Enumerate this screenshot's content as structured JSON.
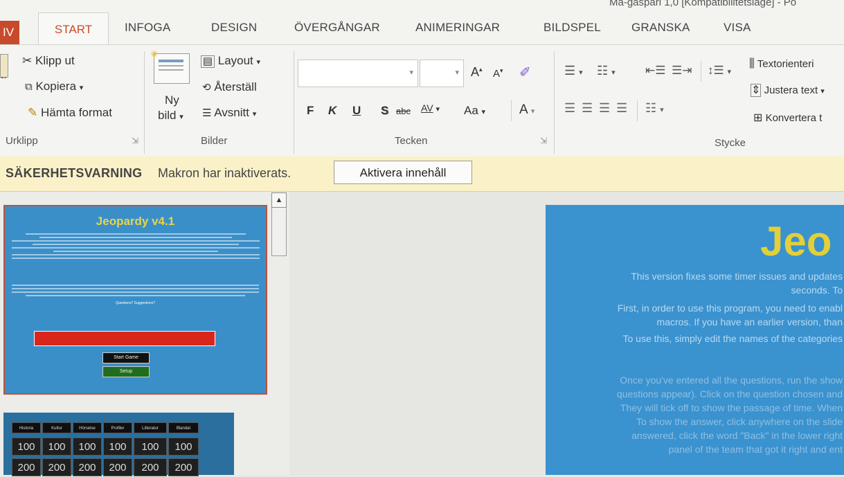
{
  "window": {
    "title": "Ma-gaspari 1,0 [Kompatibilitetslage] - Po"
  },
  "tabs": {
    "file": "IV",
    "start": "START",
    "infoga": "INFOGA",
    "design": "DESIGN",
    "overgangar": "ÖVERGÅNGAR",
    "animeringar": "ANIMERINGAR",
    "bildspel": "BILDSPEL",
    "granska": "GRANSKA",
    "visa": "VISA"
  },
  "ribbon": {
    "clipboard": {
      "cut": "Klipp ut",
      "copy": "Kopiera",
      "format_painter": "Hämta format",
      "paste_partial": "a",
      "group_label": "Urklipp"
    },
    "slides": {
      "new_slide_line1": "Ny",
      "new_slide_line2": "bild",
      "layout": "Layout",
      "reset": "Återställ",
      "section": "Avsnitt",
      "group_label": "Bilder"
    },
    "font": {
      "font_name_value": "",
      "font_size_value": "",
      "grow": "A",
      "shrink": "A",
      "bold": "F",
      "italic": "K",
      "underline": "U",
      "shadow": "S",
      "strike": "abc",
      "spacing": "AV",
      "change_case": "Aa",
      "font_color": "A",
      "group_label": "Tecken"
    },
    "paragraph": {
      "text_direction": "Textorienteri",
      "align_text": "Justera text",
      "convert": "Konvertera t",
      "group_label": "Stycke"
    }
  },
  "security_bar": {
    "title": "SÄKERHETSVARNING",
    "message": "Makron har inaktiverats.",
    "button": "Aktivera innehåll"
  },
  "thumbnails": {
    "slide1": {
      "title": "Jeopardy v4.1",
      "start_button": "Start Game",
      "setup_button": "Setup",
      "red_banner": "",
      "questions_line": "Questions? Suggestions?"
    },
    "slide2": {
      "categories": [
        "Historia",
        "Kultur",
        "Hörselse",
        "Profiler",
        "Litteratur",
        "Blandat"
      ],
      "row1": [
        "100",
        "100",
        "100",
        "100",
        "100",
        "100"
      ],
      "row2": [
        "200",
        "200",
        "200",
        "200",
        "200",
        "200"
      ]
    }
  },
  "main_slide": {
    "title_partial": "Jeo",
    "lines": [
      "This version fixes some timer issues and updates",
      "seconds. To",
      "First, in order to use this program, you need to enabl",
      "macros. If you have an earlier version, than",
      "To use this, simply edit the names of the categories",
      "Once you've entered all the questions, run the show",
      "questions appear). Click on the question chosen and",
      "They will tick off to show the passage of time. When",
      "To show the answer, click anywhere on the slide",
      "answered, click the word \"Back\" in the lower right",
      "panel of the team that got it right and ent"
    ]
  },
  "colors": {
    "accent": "#c74b2a",
    "security_bar": "#fbf1c8",
    "slide_blue": "#3b8fc9",
    "title_yellow": "#e8d44a"
  }
}
